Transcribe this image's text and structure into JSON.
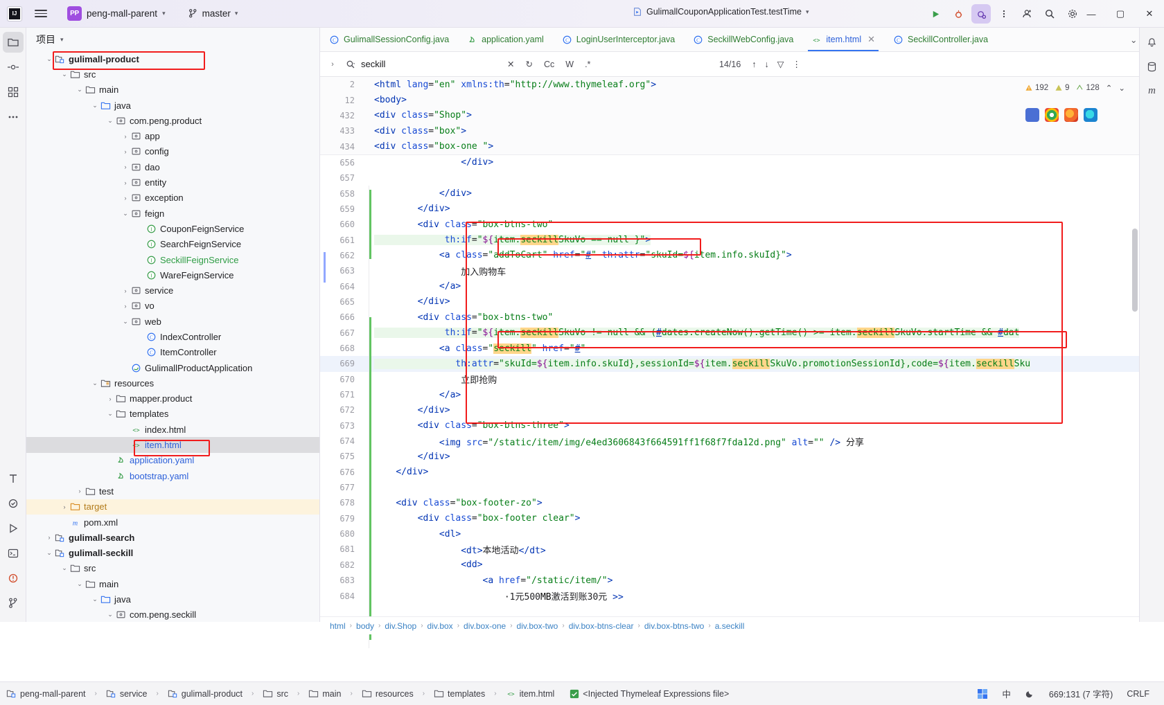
{
  "titlebar": {
    "project_badge": "PP",
    "project_name": "peng-mall-parent",
    "branch": "master",
    "run_config": "GulimallCouponApplicationTest.testTime",
    "menu_icon": "hamburger-menu-icon",
    "app_icon": "intellij-idea-logo"
  },
  "project_panel": {
    "title": "项目",
    "tree": [
      {
        "indent": 1,
        "arrow": "v",
        "icon": "module",
        "label": "gulimall-product",
        "style": "bold",
        "boxed": true
      },
      {
        "indent": 2,
        "arrow": "v",
        "icon": "folder",
        "label": "src",
        "style": ""
      },
      {
        "indent": 3,
        "arrow": "v",
        "icon": "folder",
        "label": "main",
        "style": ""
      },
      {
        "indent": 4,
        "arrow": "v",
        "icon": "folder-source",
        "label": "java",
        "style": ""
      },
      {
        "indent": 5,
        "arrow": "v",
        "icon": "package",
        "label": "com.peng.product",
        "style": ""
      },
      {
        "indent": 6,
        "arrow": ">",
        "icon": "package",
        "label": "app",
        "style": ""
      },
      {
        "indent": 6,
        "arrow": ">",
        "icon": "package",
        "label": "config",
        "style": ""
      },
      {
        "indent": 6,
        "arrow": ">",
        "icon": "package",
        "label": "dao",
        "style": ""
      },
      {
        "indent": 6,
        "arrow": ">",
        "icon": "package",
        "label": "entity",
        "style": ""
      },
      {
        "indent": 6,
        "arrow": ">",
        "icon": "package",
        "label": "exception",
        "style": ""
      },
      {
        "indent": 6,
        "arrow": "v",
        "icon": "package",
        "label": "feign",
        "style": ""
      },
      {
        "indent": 7,
        "arrow": "",
        "icon": "interface",
        "label": "CouponFeignService",
        "style": ""
      },
      {
        "indent": 7,
        "arrow": "",
        "icon": "interface",
        "label": "SearchFeignService",
        "style": ""
      },
      {
        "indent": 7,
        "arrow": "",
        "icon": "interface",
        "label": "SeckillFeignService",
        "style": "green"
      },
      {
        "indent": 7,
        "arrow": "",
        "icon": "interface",
        "label": "WareFeignService",
        "style": ""
      },
      {
        "indent": 6,
        "arrow": ">",
        "icon": "package",
        "label": "service",
        "style": ""
      },
      {
        "indent": 6,
        "arrow": ">",
        "icon": "package",
        "label": "vo",
        "style": ""
      },
      {
        "indent": 6,
        "arrow": "v",
        "icon": "package",
        "label": "web",
        "style": ""
      },
      {
        "indent": 7,
        "arrow": "",
        "icon": "class",
        "label": "IndexController",
        "style": ""
      },
      {
        "indent": 7,
        "arrow": "",
        "icon": "class",
        "label": "ItemController",
        "style": ""
      },
      {
        "indent": 6,
        "arrow": "",
        "icon": "spring-class",
        "label": "GulimallProductApplication",
        "style": ""
      },
      {
        "indent": 4,
        "arrow": "v",
        "icon": "resources",
        "label": "resources",
        "style": ""
      },
      {
        "indent": 5,
        "arrow": ">",
        "icon": "folder",
        "label": "mapper.product",
        "style": ""
      },
      {
        "indent": 5,
        "arrow": "v",
        "icon": "folder",
        "label": "templates",
        "style": ""
      },
      {
        "indent": 6,
        "arrow": "",
        "icon": "html",
        "label": "index.html",
        "style": ""
      },
      {
        "indent": 6,
        "arrow": "",
        "icon": "html",
        "label": "item.html",
        "style": "selected-blue",
        "boxed": true,
        "selected": true
      },
      {
        "indent": 5,
        "arrow": "",
        "icon": "yaml",
        "label": "application.yaml",
        "style": "blue"
      },
      {
        "indent": 5,
        "arrow": "",
        "icon": "yaml",
        "label": "bootstrap.yaml",
        "style": "blue"
      },
      {
        "indent": 3,
        "arrow": ">",
        "icon": "folder",
        "label": "test",
        "style": ""
      },
      {
        "indent": 2,
        "arrow": ">",
        "icon": "folder-excluded",
        "label": "target",
        "style": "orange",
        "highlight": "target"
      },
      {
        "indent": 2,
        "arrow": "",
        "icon": "maven",
        "label": "pom.xml",
        "style": ""
      },
      {
        "indent": 1,
        "arrow": ">",
        "icon": "module",
        "label": "gulimall-search",
        "style": "bold"
      },
      {
        "indent": 1,
        "arrow": "v",
        "icon": "module",
        "label": "gulimall-seckill",
        "style": "bold"
      },
      {
        "indent": 2,
        "arrow": "v",
        "icon": "folder",
        "label": "src",
        "style": ""
      },
      {
        "indent": 3,
        "arrow": "v",
        "icon": "folder",
        "label": "main",
        "style": ""
      },
      {
        "indent": 4,
        "arrow": "v",
        "icon": "folder-source",
        "label": "java",
        "style": ""
      },
      {
        "indent": 5,
        "arrow": "v",
        "icon": "package",
        "label": "com.peng.seckill",
        "style": ""
      }
    ]
  },
  "editor": {
    "tabs": [
      {
        "label": "GulimallSessionConfig.java",
        "icon": "class-icon",
        "active": false
      },
      {
        "label": "application.yaml",
        "icon": "yaml-icon",
        "active": false
      },
      {
        "label": "LoginUserInterceptor.java",
        "icon": "class-icon",
        "active": false
      },
      {
        "label": "SeckillWebConfig.java",
        "icon": "class-icon",
        "active": false
      },
      {
        "label": "item.html",
        "icon": "html-icon",
        "active": true
      },
      {
        "label": "SeckillController.java",
        "icon": "class-icon",
        "active": false
      }
    ],
    "find": {
      "query": "seckill",
      "placeholder": "Search",
      "match_count": "14/16",
      "option_case": "Cc",
      "option_word": "W",
      "option_regex": ".*",
      "close_label": "✕"
    },
    "inspections": {
      "warnings": "192",
      "weak_warnings": "9",
      "other": "128"
    },
    "sticky_lines": [
      {
        "num": "2",
        "text": "<html lang=\"en\" xmlns:th=\"http://www.thymeleaf.org\">"
      },
      {
        "num": "12",
        "text": "<body>"
      },
      {
        "num": "432",
        "text": "<div class=\"Shop\">"
      },
      {
        "num": "433",
        "text": "<div class=\"box\">"
      },
      {
        "num": "434",
        "text": "<div class=\"box-one \">"
      }
    ],
    "lines": [
      {
        "num": "656",
        "text": "                </div>"
      },
      {
        "num": "657",
        "text": ""
      },
      {
        "num": "658",
        "text": "            </div>"
      },
      {
        "num": "659",
        "text": "        </div>"
      },
      {
        "num": "660",
        "text": "        <div class=\"box-btns-two\""
      },
      {
        "num": "661",
        "text": "             th:if=\"${item.seckillSkuVo == null }\">"
      },
      {
        "num": "662",
        "text": "            <a class=\"addToCart\" href=\"#\" th:attr=\"skuId=${item.info.skuId}\">"
      },
      {
        "num": "663",
        "text": "                加入购物车"
      },
      {
        "num": "664",
        "text": "            </a>"
      },
      {
        "num": "665",
        "text": "        </div>"
      },
      {
        "num": "666",
        "text": "        <div class=\"box-btns-two\""
      },
      {
        "num": "667",
        "text": "             th:if=\"${item.seckillSkuVo != null && (#dates.createNow().getTime() >= item.seckillSkuVo.startTime && #dat"
      },
      {
        "num": "668",
        "text": "            <a class=\"seckill\" href=\"#\""
      },
      {
        "num": "669",
        "text": "               th:attr=\"skuId=${item.info.skuId},sessionId=${item.seckillSkuVo.promotionSessionId},code=${item.seckillSku"
      },
      {
        "num": "670",
        "text": "                立即抢购"
      },
      {
        "num": "671",
        "text": "            </a>"
      },
      {
        "num": "672",
        "text": "        </div>"
      },
      {
        "num": "673",
        "text": "        <div class=\"box-btns-three\">"
      },
      {
        "num": "674",
        "text": "            <img src=\"/static/item/img/e4ed3606843f664591ff1f68f7fda12d.png\" alt=\"\" /> 分享"
      },
      {
        "num": "675",
        "text": "        </div>"
      },
      {
        "num": "676",
        "text": "    </div>"
      },
      {
        "num": "677",
        "text": ""
      },
      {
        "num": "678",
        "text": "    <div class=\"box-footer-zo\">"
      },
      {
        "num": "679",
        "text": "        <div class=\"box-footer clear\">"
      },
      {
        "num": "680",
        "text": "            <dl>"
      },
      {
        "num": "681",
        "text": "                <dt>本地活动</dt>"
      },
      {
        "num": "682",
        "text": "                <dd>"
      },
      {
        "num": "683",
        "text": "                    <a href=\"/static/item/\">"
      },
      {
        "num": "684",
        "text": "                        ·1元500MB激活到账30元 >>"
      }
    ],
    "breadcrumbs": [
      "html",
      "body",
      "div.Shop",
      "div.box",
      "div.box-one",
      "div.box-two",
      "div.box-btns-clear",
      "div.box-btns-two",
      "a.seckill"
    ]
  },
  "status_bar": {
    "left_items": [
      {
        "icon": "module-icon",
        "label": "peng-mall-parent"
      },
      {
        "icon": "module-icon",
        "label": "service"
      },
      {
        "icon": "module-icon",
        "label": "gulimall-product"
      },
      {
        "icon": "folder-icon",
        "label": "src"
      },
      {
        "icon": "folder-icon",
        "label": "main"
      },
      {
        "icon": "folder-icon",
        "label": "resources"
      },
      {
        "icon": "folder-icon",
        "label": "templates"
      },
      {
        "icon": "html-icon",
        "label": "item.html"
      }
    ],
    "injection_note": "<Injected Thymeleaf Expressions file>",
    "caret": "669:131 (7 字符)",
    "line_sep": "CRLF",
    "ime": "中"
  },
  "colors": {
    "accent_blue": "#3574f0",
    "highlight_red": "#f11c1c",
    "match_orange": "#ffd68a",
    "selection_blue": "#a6c9f7",
    "green_text": "#2f9d45",
    "purple_badge": "#9f4ee0"
  }
}
